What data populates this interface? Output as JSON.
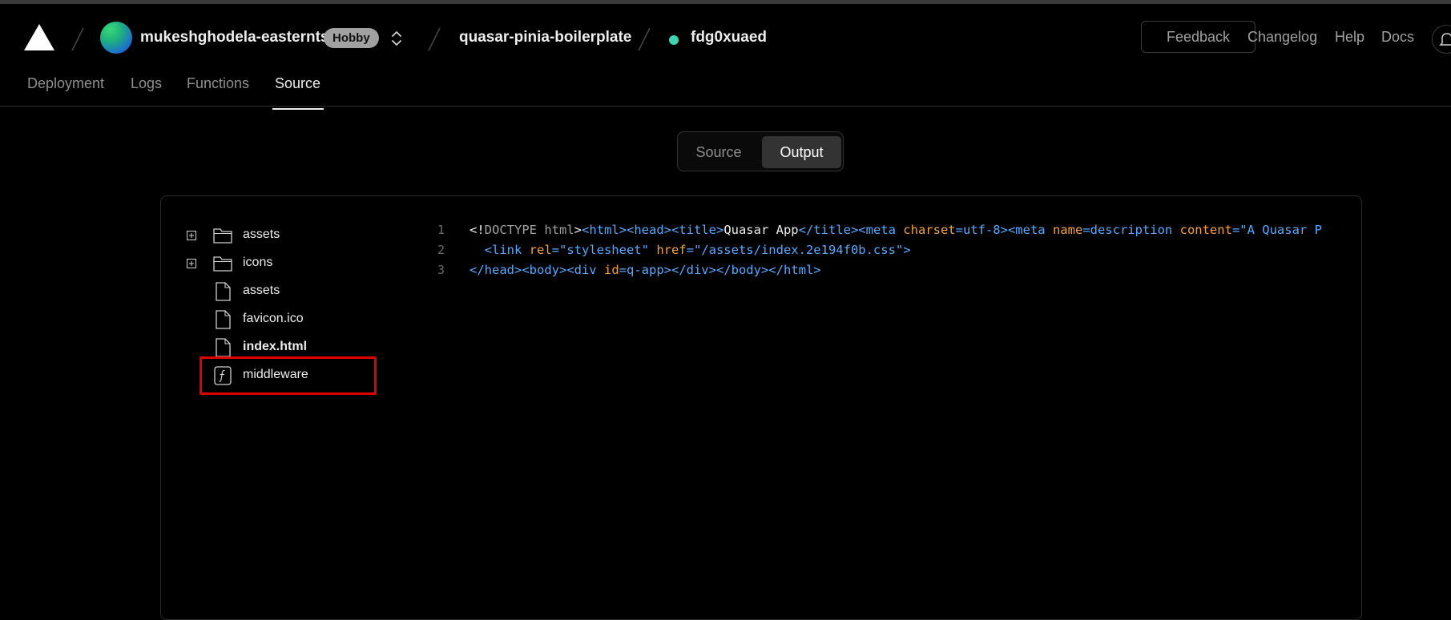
{
  "header": {
    "team_name": "mukeshghodela-easternts",
    "plan_badge": "Hobby",
    "project_name": "quasar-pinia-boilerplate",
    "deployment_id": "fdg0xuaed",
    "status_color": "#3fd3b0",
    "feedback_label": "Feedback",
    "links": [
      "Changelog",
      "Help",
      "Docs"
    ]
  },
  "tabs": [
    "Deployment",
    "Logs",
    "Functions",
    "Source"
  ],
  "active_tab": "Source",
  "toggle": {
    "source_label": "Source",
    "output_label": "Output",
    "selected": "Output"
  },
  "file_tree": [
    {
      "name": "assets",
      "type": "folder",
      "expandable": true
    },
    {
      "name": "icons",
      "type": "folder",
      "expandable": true
    },
    {
      "name": "assets",
      "type": "file"
    },
    {
      "name": "favicon.ico",
      "type": "file"
    },
    {
      "name": "index.html",
      "type": "file",
      "selected": true
    },
    {
      "name": "middleware",
      "type": "function",
      "highlighted": true
    }
  ],
  "code": {
    "line_numbers": [
      "1",
      "2",
      "3"
    ],
    "line1": {
      "t1": "<!",
      "t2": "DOCTYPE html",
      "t3": ">",
      "t4": "<html><head><title>",
      "t5": "Quasar App",
      "t6": "</title><meta ",
      "t7": "charset",
      "t8": "=utf-8><meta ",
      "t9": "name",
      "t10": "=description ",
      "t11": "content",
      "t12": "=\"A Quasar P"
    },
    "line2": {
      "t1": "  <link ",
      "t2": "rel",
      "t3": "=\"stylesheet\" ",
      "t4": "href",
      "t5": "=\"/assets/index.2e194f0b.css\">"
    },
    "line3": {
      "t1": "</head><body><div ",
      "t2": "id",
      "t3": "=q-app></div></body></html>"
    }
  }
}
